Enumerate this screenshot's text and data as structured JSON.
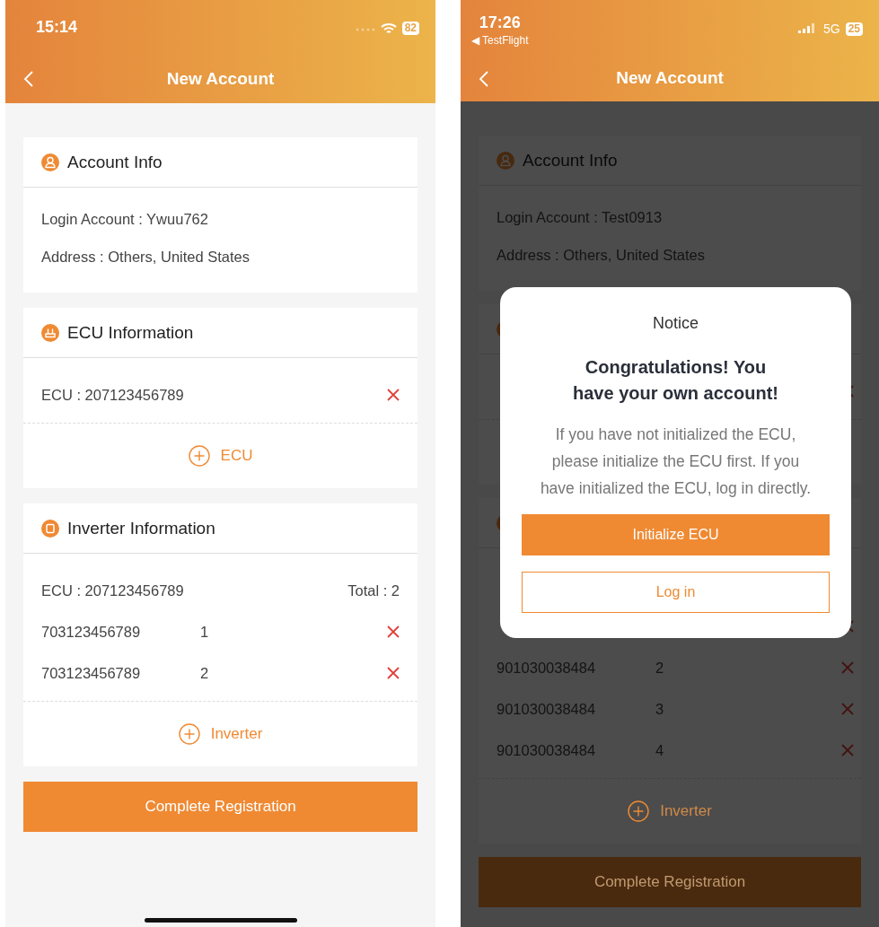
{
  "screens": [
    {
      "status_bar": {
        "time": "15:14",
        "battery": "82"
      },
      "nav": {
        "title": "New Account"
      },
      "account_info": {
        "title": "Account Info",
        "lines": [
          "Login Account : Ywuu762",
          "Address : Others, United States"
        ]
      },
      "ecu_information": {
        "title": "ECU Information",
        "items": [
          {
            "label": "ECU : 207123456789",
            "deletable": true
          }
        ],
        "add_label": "ECU"
      },
      "inverter_information": {
        "title": "Inverter Information",
        "summary": {
          "ecu": "ECU : 207123456789",
          "total": "Total : 2"
        },
        "rows": [
          {
            "serial": "703123456789",
            "index": "1",
            "deletable": true
          },
          {
            "serial": "703123456789",
            "index": "2",
            "deletable": true
          }
        ],
        "add_label": "Inverter"
      },
      "submit": "Complete Registration"
    },
    {
      "status_bar": {
        "time": "17:26",
        "back_app": "◀ TestFlight",
        "network": "5G",
        "battery": "25"
      },
      "nav": {
        "title": "New Account"
      },
      "account_info": {
        "title": "Account Info",
        "lines": [
          "Login Account : Test0913",
          "Address : Others, United States"
        ]
      },
      "ecu_information": {
        "items": [
          {
            "deletable": true
          }
        ]
      },
      "inverter_information": {
        "rows": [
          {
            "deletable": true
          },
          {
            "serial": "901030038484",
            "index": "2",
            "deletable": true
          },
          {
            "serial": "901030038484",
            "index": "3",
            "deletable": true
          },
          {
            "serial": "901030038484",
            "index": "4",
            "deletable": true
          }
        ],
        "add_label": "Inverter"
      },
      "submit": "Complete Registration",
      "dialog": {
        "title": "Notice",
        "heading": "Congratulations! You have your own account!",
        "message": "If you have not initialized the ECU, please initialize the ECU first. If you have initialized the ECU, log in directly.",
        "primary": "Initialize ECU",
        "secondary": "Log in"
      }
    }
  ]
}
